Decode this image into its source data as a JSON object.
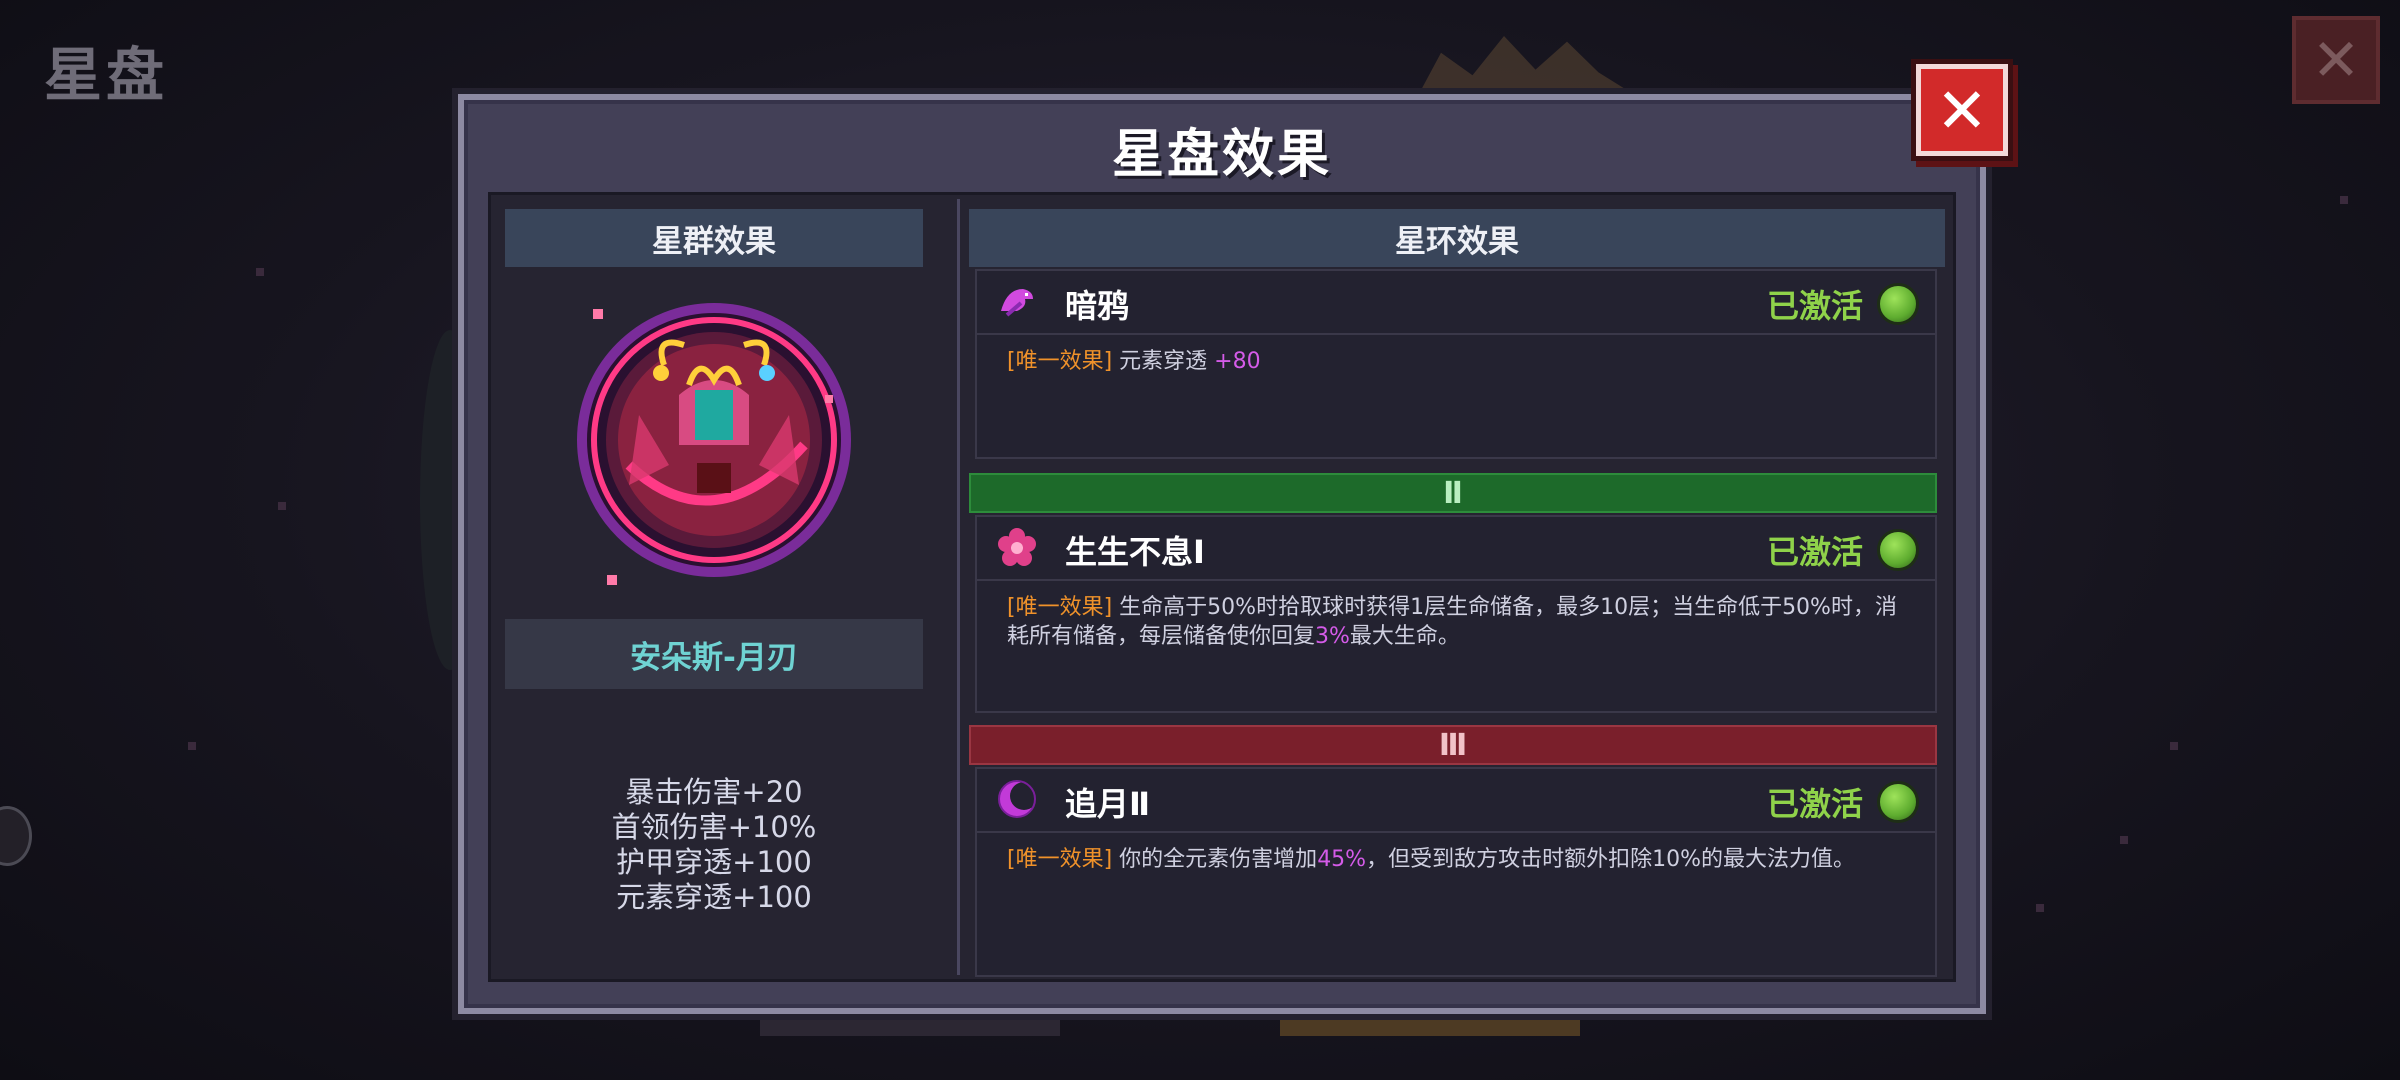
{
  "background": {
    "title": "星盘",
    "close_glyph": "✕"
  },
  "panel": {
    "title": "星盘效果",
    "close_glyph": "✕"
  },
  "left": {
    "header": "星群效果",
    "constellation_name": "安朵斯-月刃",
    "stats": [
      "暴击伤害+20",
      "首领伤害+10%",
      "护甲穿透+100",
      "元素穿透+100"
    ]
  },
  "right": {
    "header": "星环效果",
    "effects": [
      {
        "icon": "raven-icon",
        "name": "暗鸦",
        "status": "已激活",
        "tag": "[唯一效果]",
        "desc_parts": [
          "元素穿透 ",
          "+80",
          ""
        ]
      },
      {
        "icon": "flower-icon",
        "name": "生生不息Ⅰ",
        "status": "已激活",
        "tag": "[唯一效果]",
        "desc_parts": [
          "生命高于50%时拾取球时获得1层生命储备，最多10层；当生命低于50%时，消耗所有储备，每层储备使你回复",
          "3%",
          "最大生命。"
        ]
      },
      {
        "icon": "crescent-moon-icon",
        "name": "追月Ⅱ",
        "status": "已激活",
        "tag": "[唯一效果]",
        "desc_parts": [
          "你的全元素伤害增加",
          "45%",
          "，但受到敌方攻击时额外扣除10%的最大法力值。"
        ]
      }
    ],
    "tiers": [
      {
        "label": "Ⅱ",
        "color": "#1d6a2a"
      },
      {
        "label": "Ⅲ",
        "color": "#7a1f2b"
      }
    ]
  },
  "colors": {
    "status_green": "#8fd24a",
    "tag_orange": "#f0922a",
    "highlight_purple": "#d45be8",
    "name_cyan": "#6fd3d3",
    "close_red": "#d22a2a"
  }
}
